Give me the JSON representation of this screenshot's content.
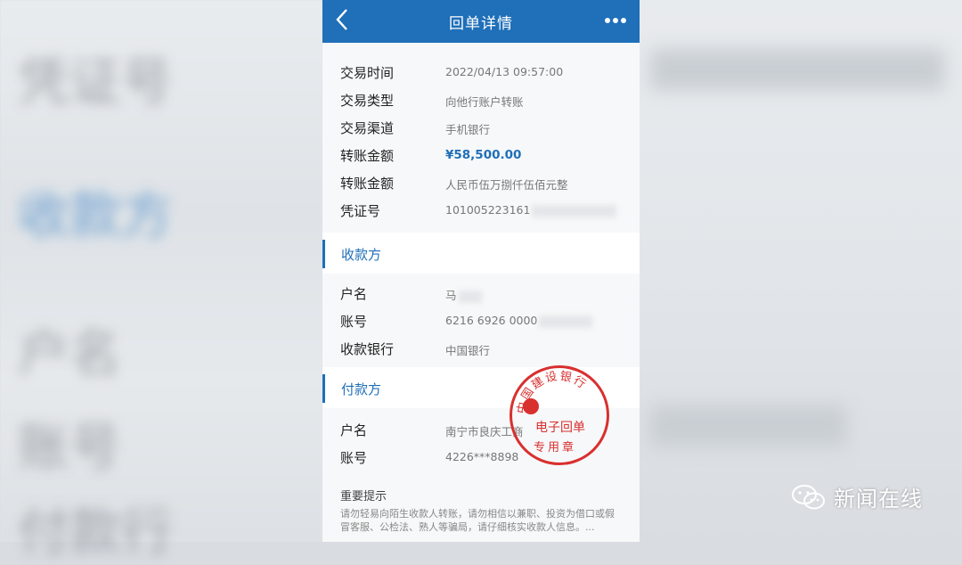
{
  "header": {
    "title": "回单详情",
    "back_icon": "chevron-left-icon",
    "more_icon": "more-dots-icon",
    "color": "#1f6fb9"
  },
  "transaction": {
    "rows": [
      {
        "label": "交易时间",
        "value": "2022/04/13  09:57:00"
      },
      {
        "label": "交易类型",
        "value": "向他行账户转账"
      },
      {
        "label": "交易渠道",
        "value": "手机银行"
      },
      {
        "label": "转账金额",
        "value": "¥58,500.00"
      },
      {
        "label": "转账金额",
        "value": "人民币伍万捌仟伍佰元整"
      },
      {
        "label": "凭证号",
        "value": "101005223161"
      }
    ]
  },
  "payee": {
    "section_title": "收款方",
    "rows": [
      {
        "label": "户名",
        "value": "马"
      },
      {
        "label": "账号",
        "value": "6216 6926 0000"
      },
      {
        "label": "收款银行",
        "value": "中国银行"
      }
    ]
  },
  "payer": {
    "section_title": "付款方",
    "rows": [
      {
        "label": "户名",
        "value": "南宁市良庆工商"
      },
      {
        "label": "账号",
        "value": "4226***8898"
      }
    ]
  },
  "notice": {
    "title": "重要提示",
    "body": "请勿轻易向陌生收款人转账，请勿相信以兼职、投资为借口或假冒客服、公检法、熟人等骗局，请仔细核实收款人信息。..."
  },
  "seal": {
    "ring_text": "中国建设银行",
    "line1": "电子回单",
    "line2": "专用章",
    "color": "#d8302f"
  },
  "watermark": {
    "text": "新闻在线",
    "icon": "wechat-icon"
  },
  "background": {
    "texts": [
      "凭证号",
      "收款方",
      "户名",
      "账号",
      "付款行"
    ]
  }
}
